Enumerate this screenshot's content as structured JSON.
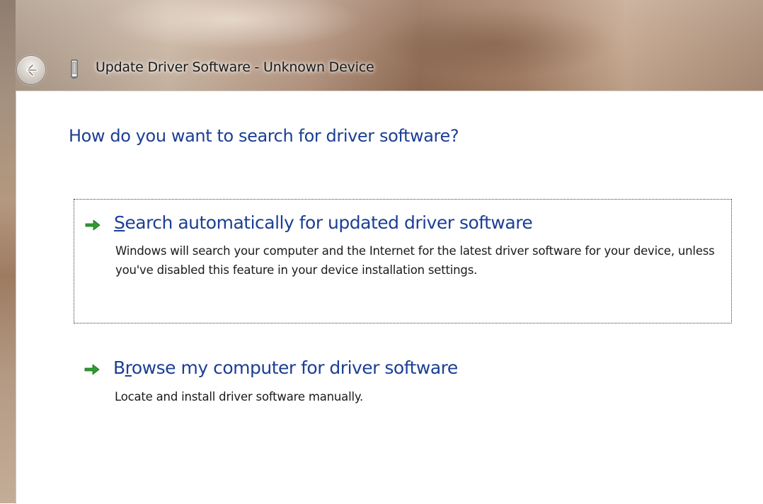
{
  "window": {
    "title": "Update Driver Software - Unknown Device"
  },
  "page": {
    "heading": "How do you want to search for driver software?"
  },
  "options": [
    {
      "title_mnemonic": "S",
      "title_rest": "earch automatically for updated driver software",
      "description": "Windows will search your computer and the Internet for the latest driver software for your device, unless you've disabled this feature in your device installation settings.",
      "focused": true
    },
    {
      "title_before": "B",
      "title_mnemonic": "r",
      "title_rest": "owse my computer for driver software",
      "description": "Locate and install driver software manually.",
      "focused": false
    }
  ],
  "colors": {
    "heading": "#1c3f94",
    "arrow": "#2f9c2f",
    "text": "#1a1a1a"
  },
  "icons": {
    "back": "back-arrow-icon",
    "device": "unknown-device-icon",
    "option": "green-arrow-icon"
  }
}
